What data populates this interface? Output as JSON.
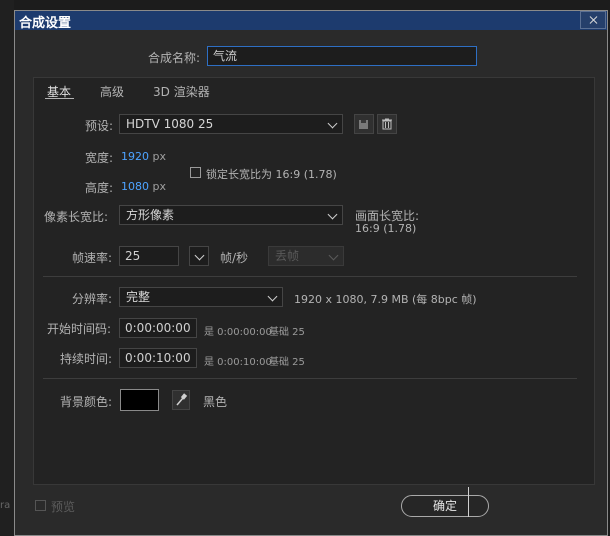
{
  "window": {
    "title": "合成设置"
  },
  "comp_name": {
    "label": "合成名称:",
    "value": "气流"
  },
  "tabs": [
    {
      "label": "基本"
    },
    {
      "label": "高级"
    },
    {
      "label": "3D 渲染器"
    }
  ],
  "preset": {
    "label": "预设:",
    "value": "HDTV 1080 25"
  },
  "width": {
    "label": "宽度:",
    "value": "1920",
    "unit": "px"
  },
  "height": {
    "label": "高度:",
    "value": "1080",
    "unit": "px"
  },
  "lock_aspect": {
    "label": "锁定长宽比为 16:9 (1.78)"
  },
  "pixel_aspect": {
    "label": "像素长宽比:",
    "value": "方形像素"
  },
  "frame_aspect": {
    "label": "画面长宽比:",
    "value": "16:9 (1.78)"
  },
  "frame_rate": {
    "label": "帧速率:",
    "value": "25",
    "unit": "帧/秒",
    "drop_frame": "丢帧"
  },
  "resolution": {
    "label": "分辨率:",
    "value": "完整",
    "info": "1920 x 1080, 7.9 MB (每 8bpc 帧)"
  },
  "start_timecode": {
    "label": "开始时间码:",
    "value": "0:00:00:00",
    "equals": "是 0:00:00:00",
    "base": "基础 25"
  },
  "duration": {
    "label": "持续时间:",
    "value": "0:00:10:00",
    "equals": "是 0:00:10:00",
    "base": "基础 25"
  },
  "background": {
    "label": "背景颜色:",
    "color_name": "黑色",
    "color": "#000000"
  },
  "footer": {
    "preview_label": "预览",
    "ok_label": "确定"
  },
  "colors": {
    "titlebar": "#1d3b6e",
    "accent_blue": "#4da3ff",
    "panel": "#232323"
  },
  "icons": [
    "close-icon",
    "save-preset-icon",
    "trash-icon",
    "checkbox-icon",
    "chevron-down-icon",
    "eyedropper-icon"
  ]
}
